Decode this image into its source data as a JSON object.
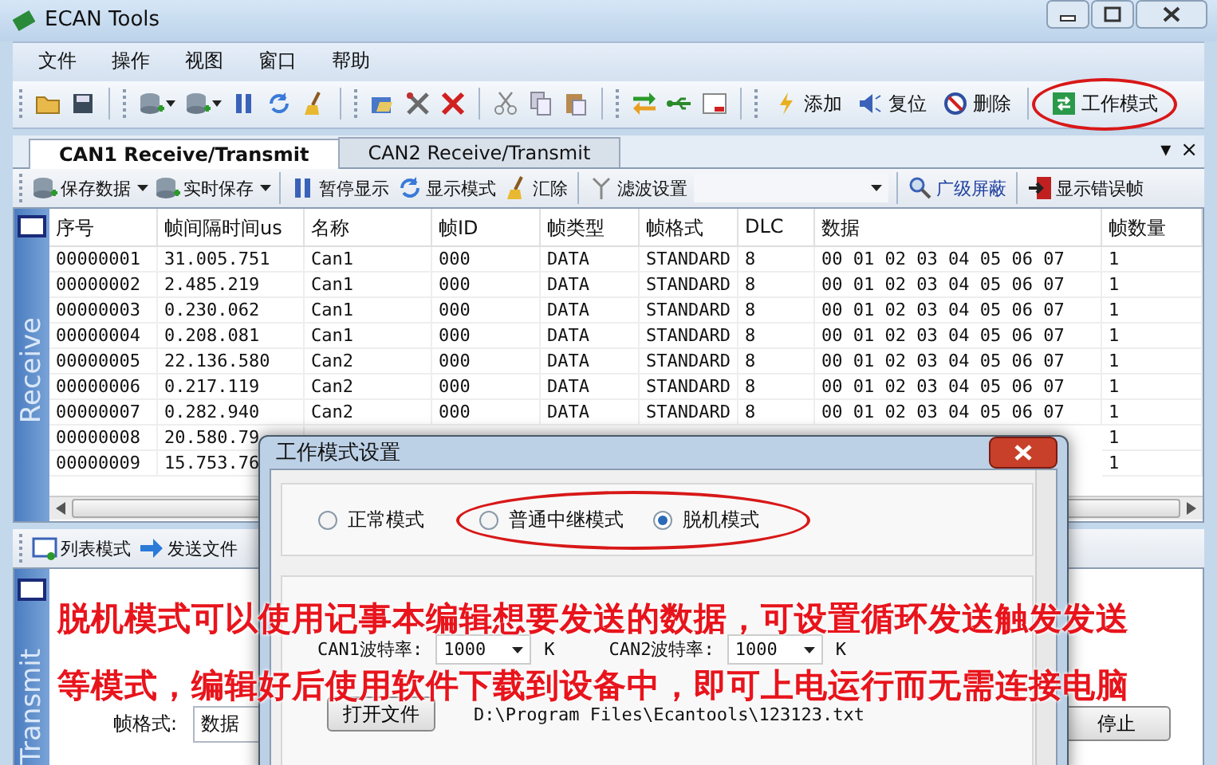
{
  "window": {
    "title": "ECAN Tools"
  },
  "menu": [
    "文件",
    "操作",
    "视图",
    "窗口",
    "帮助"
  ],
  "toolbar": {
    "buttons": [
      {
        "label": "添加",
        "circled": false
      },
      {
        "label": "复位",
        "circled": false
      },
      {
        "label": "删除",
        "circled": false
      },
      {
        "label": "工作模式",
        "circled": true
      }
    ]
  },
  "tabs": [
    {
      "label": "CAN1 Receive/Transmit",
      "selected": true
    },
    {
      "label": "CAN2 Receive/Transmit",
      "selected": false
    }
  ],
  "tab_controls": [
    "▾",
    "×"
  ],
  "receive_toolbar": [
    {
      "label": "保存数据",
      "dropdown": true
    },
    {
      "label": "实时保存",
      "dropdown": true
    },
    {
      "label": "暂停显示",
      "dropdown": false
    },
    {
      "label": "显示模式",
      "dropdown": false
    },
    {
      "label": "汇除",
      "dropdown": false
    },
    {
      "label": "滤波设置",
      "dropdown": false
    },
    {
      "label": "广级屏蔽",
      "dropdown": false
    },
    {
      "label": "显示错误帧",
      "dropdown": false
    }
  ],
  "receive": {
    "side_label": "Receive",
    "columns": [
      "序号",
      "帧间隔时间us",
      "名称",
      "帧ID",
      "帧类型",
      "帧格式",
      "DLC",
      "数据",
      "帧数量"
    ],
    "rows": [
      [
        "00000001",
        "31.005.751",
        "Can1",
        "000",
        "DATA",
        "STANDARD",
        "8",
        "00 01 02 03 04 05 06 07",
        "1"
      ],
      [
        "00000002",
        "2.485.219",
        "Can1",
        "000",
        "DATA",
        "STANDARD",
        "8",
        "00 01 02 03 04 05 06 07",
        "1"
      ],
      [
        "00000003",
        "0.230.062",
        "Can1",
        "000",
        "DATA",
        "STANDARD",
        "8",
        "00 01 02 03 04 05 06 07",
        "1"
      ],
      [
        "00000004",
        "0.208.081",
        "Can1",
        "000",
        "DATA",
        "STANDARD",
        "8",
        "00 01 02 03 04 05 06 07",
        "1"
      ],
      [
        "00000005",
        "22.136.580",
        "Can2",
        "000",
        "DATA",
        "STANDARD",
        "8",
        "00 01 02 03 04 05 06 07",
        "1"
      ],
      [
        "00000006",
        "0.217.119",
        "Can2",
        "000",
        "DATA",
        "STANDARD",
        "8",
        "00 01 02 03 04 05 06 07",
        "1"
      ],
      [
        "00000007",
        "0.282.940",
        "Can2",
        "000",
        "DATA",
        "STANDARD",
        "8",
        "00 01 02 03 04 05 06 07",
        "1"
      ],
      [
        "00000008",
        "20.580.79",
        null,
        null,
        null,
        null,
        null,
        null,
        "1"
      ],
      [
        "00000009",
        "15.753.76",
        null,
        null,
        null,
        null,
        null,
        null,
        "1"
      ]
    ]
  },
  "transmit_toolbar": [
    "列表模式",
    "发送文件"
  ],
  "transmit": {
    "side_label": "Transmit",
    "fields": [
      {
        "label": "帧格式:",
        "value": "数据"
      }
    ],
    "buttons": [
      "停止"
    ]
  },
  "dialog": {
    "title": "工作模式设置",
    "modes": [
      {
        "label": "正常模式",
        "selected": false,
        "circled": false
      },
      {
        "label": "普通中继模式",
        "selected": false,
        "circled": true
      },
      {
        "label": "脱机模式",
        "selected": true,
        "circled": true
      }
    ],
    "baud": [
      {
        "label": "CAN1波特率:",
        "value": "1000",
        "unit": "K"
      },
      {
        "label": "CAN2波特率:",
        "value": "1000",
        "unit": "K"
      }
    ],
    "open_button": "打开文件",
    "file_path": "D:\\Program Files\\Ecantools\\123123.txt"
  },
  "caption": [
    "脱机模式可以使用记事本编辑想要发送的数据，可设置循环发送触发发送",
    "等模式，编辑好后使用软件下载到设备中，即可上电运行而无需连接电脑"
  ]
}
